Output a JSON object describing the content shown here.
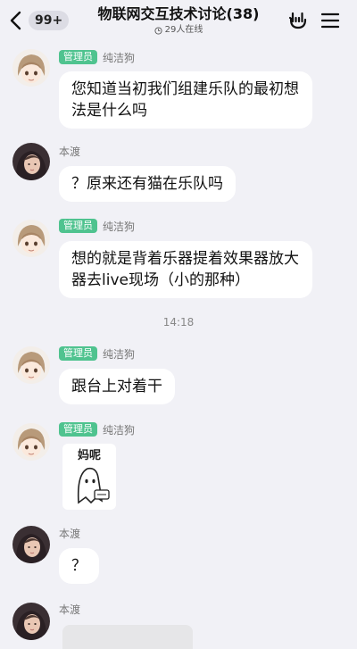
{
  "header": {
    "unread_count": "99+",
    "title": "物联网交互技术讨论(38)",
    "online_text": "29人在线"
  },
  "messages": [
    {
      "role": "管理员",
      "sender": "纯洁狗",
      "text": "您知道当初我们组建乐队的最初想法是什么吗"
    },
    {
      "sender": "本渡",
      "text": "？原来还有猫在乐队吗"
    },
    {
      "role": "管理员",
      "sender": "纯洁狗",
      "text": "想的就是背着乐器提着效果器放大器去live现场（小的那种）"
    },
    {
      "role": "管理员",
      "sender": "纯洁狗",
      "text": "跟台上对着干"
    },
    {
      "role": "管理员",
      "sender": "纯洁狗",
      "sticker_text": "妈呢"
    },
    {
      "sender": "本渡",
      "text": "？"
    },
    {
      "sender": "本渡"
    }
  ],
  "timestamp": "14:18",
  "colors": {
    "background": "#f1f1f6",
    "badge": "#4fc38f",
    "bubble": "#ffffff"
  },
  "icons": {
    "back": "chevron-left-icon",
    "online": "clock-icon",
    "hand": "rock-hand-icon",
    "menu": "hamburger-menu-icon"
  }
}
